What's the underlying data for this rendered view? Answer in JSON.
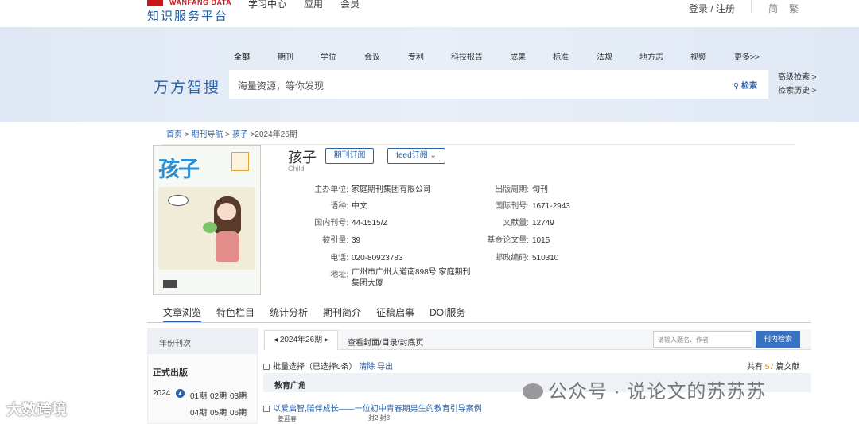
{
  "header": {
    "logo_en": "WANFANG DATA",
    "logo_cn": "知识服务平台",
    "nav": [
      "学习中心",
      "应用",
      "会员"
    ],
    "login": "登录 / 注册",
    "lang_simplified": "简",
    "lang_traditional": "繁"
  },
  "search": {
    "brand": "万方智搜",
    "categories": [
      "全部",
      "期刊",
      "学位",
      "会议",
      "专利",
      "科技报告",
      "成果",
      "标准",
      "法规",
      "地方志",
      "视频",
      "更多>>"
    ],
    "placeholder": "海量资源，等你发现",
    "button": "检索",
    "advanced": "高级检索 >",
    "history": "检索历史 >"
  },
  "breadcrumb": {
    "home": "首页",
    "sep1": " > ",
    "nav": "期刊导航",
    "sep2": " > ",
    "journal": "孩子",
    "current": " >2024年26期"
  },
  "journal": {
    "title": "孩子",
    "subtitle": "Child",
    "subscribe": "期刊订阅",
    "feed": "feed订阅",
    "cover_title": "孩子",
    "info_left": [
      {
        "k": "主办单位:",
        "v": "家庭期刊集团有限公司"
      },
      {
        "k": "语种:",
        "v": "中文"
      },
      {
        "k": "国内刊号:",
        "v": "44-1515/Z"
      },
      {
        "k": "被引量:",
        "v": "39"
      },
      {
        "k": "电话:",
        "v": "020-80923783"
      },
      {
        "k": "地址:",
        "v": "广州市广州大道南898号 家庭期刊集团大厦"
      }
    ],
    "info_right": [
      {
        "k": "出版周期:",
        "v": "旬刊"
      },
      {
        "k": "国际刊号:",
        "v": "1671-2943"
      },
      {
        "k": "文献量:",
        "v": "12749"
      },
      {
        "k": "基金论文量:",
        "v": "1015"
      },
      {
        "k": "邮政编码:",
        "v": "510310"
      }
    ]
  },
  "tabs": [
    "文章浏览",
    "特色栏目",
    "统计分析",
    "期刊简介",
    "征稿启事",
    "DOI服务"
  ],
  "sidebar": {
    "header": "年份刊次",
    "section": "正式出版",
    "year": "2024",
    "issues_row1": [
      "01期",
      "02期",
      "03期"
    ],
    "issues_row2": [
      "04期",
      "05期",
      "06期"
    ]
  },
  "content": {
    "tab_issue": "2024年26期",
    "tab_cover": "查看封面/目录/封底页",
    "search_placeholder": "请输入题名、作者",
    "search_button": "刊内检索",
    "batch_label": "批量选择",
    "batch_count": "（已选择0条）",
    "clear": "清除",
    "export": "导出",
    "total_prefix": "共有 ",
    "total_num": "57",
    "total_suffix": " 篇文献",
    "section_title": "教育广角",
    "article_title": "以爱启智,陪伴成长——一位初中青春期男生的教育引导案例",
    "article_author": "姜迎春",
    "article_pages": "封2,封3"
  },
  "watermarks": {
    "left": "大数跨境",
    "right": "公众号 · 说论文的苏苏苏"
  }
}
